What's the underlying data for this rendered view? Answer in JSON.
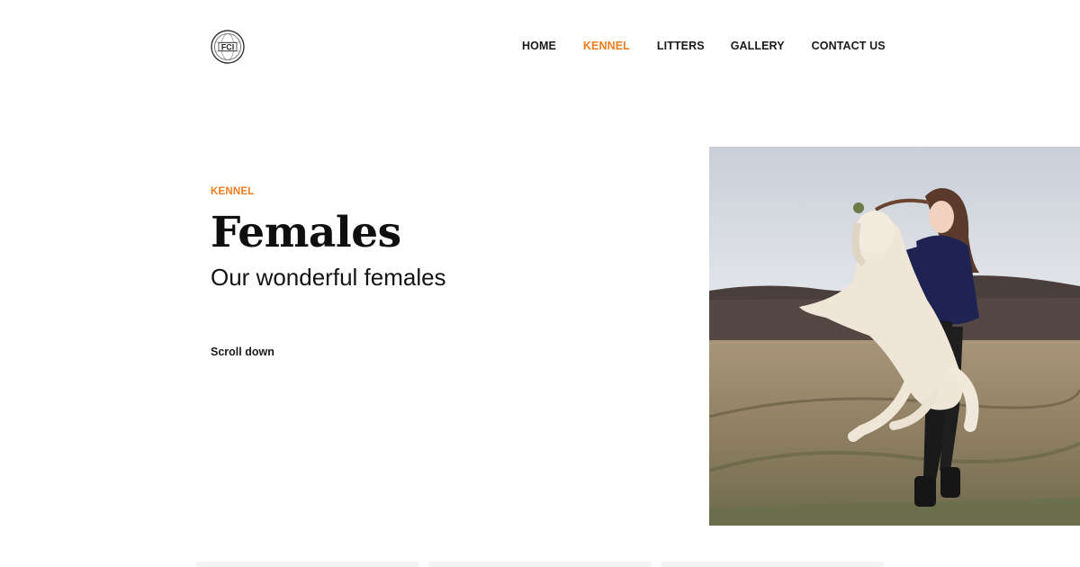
{
  "header": {
    "logo": {
      "text": "FCI",
      "icon": "fci-globe-logo-icon"
    },
    "nav": {
      "items": [
        {
          "label": "HOME",
          "active": false
        },
        {
          "label": "KENNEL",
          "active": true
        },
        {
          "label": "LITTERS",
          "active": false
        },
        {
          "label": "GALLERY",
          "active": false
        },
        {
          "label": "CONTACT US",
          "active": false
        }
      ]
    }
  },
  "hero": {
    "eyebrow": "KENNEL",
    "title": "Females",
    "subtitle": "Our wonderful females",
    "scroll_label": "Scroll down",
    "image": {
      "subject": "woman-playing-with-white-golden-retriever-in-field"
    }
  },
  "colors": {
    "accent": "#f07d1f",
    "text": "#111111",
    "background": "#ffffff"
  }
}
